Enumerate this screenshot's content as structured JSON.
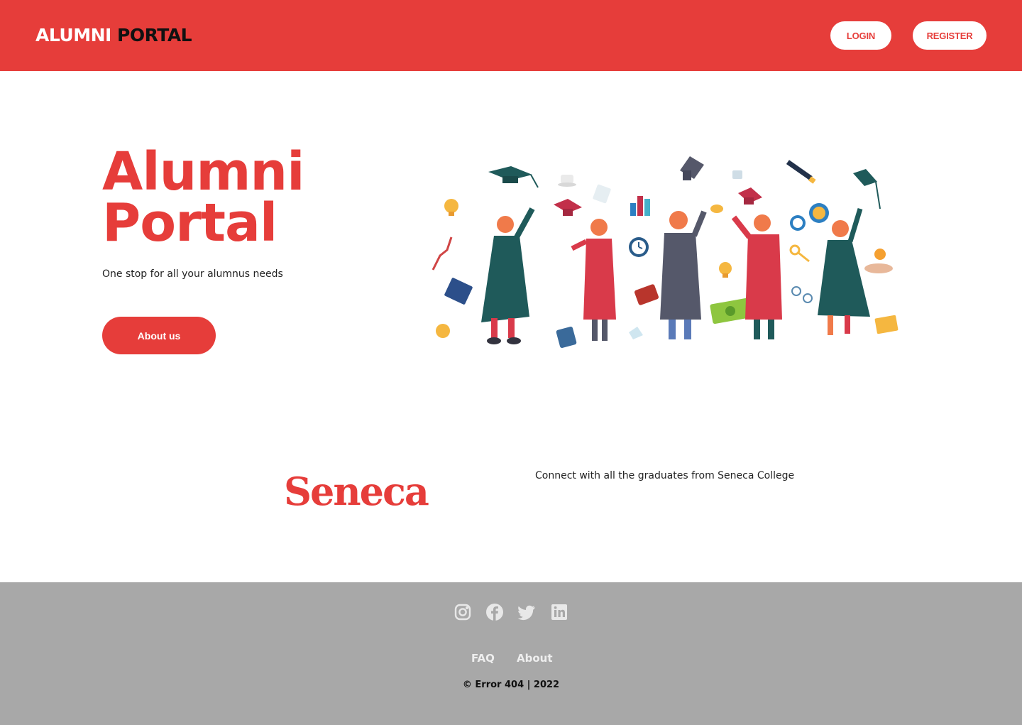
{
  "header": {
    "brand_part1": "ALUMNI",
    "brand_part2": "PORTAL",
    "login_label": "LOGIN",
    "register_label": "REGISTER"
  },
  "hero": {
    "title_line1": "Alumni",
    "title_line2": "Portal",
    "subtitle": "One stop for all your alumnus needs",
    "cta_label": "About us",
    "illustration": "graduates-celebration-illustration"
  },
  "partner": {
    "logo_text": "Seneca",
    "description": "Connect with all the graduates from Seneca College"
  },
  "footer": {
    "social_icons": [
      "instagram-icon",
      "facebook-icon",
      "twitter-icon",
      "linkedin-icon"
    ],
    "links": {
      "faq": "FAQ",
      "about": "About"
    },
    "copyright": "© Error 404 | 2022"
  },
  "colors": {
    "brand_red": "#e63d3a",
    "footer_gray": "#a8a8a8",
    "robe_teal": "#1f5a5a",
    "robe_red": "#d93a4a",
    "robe_slate": "#55586a"
  }
}
